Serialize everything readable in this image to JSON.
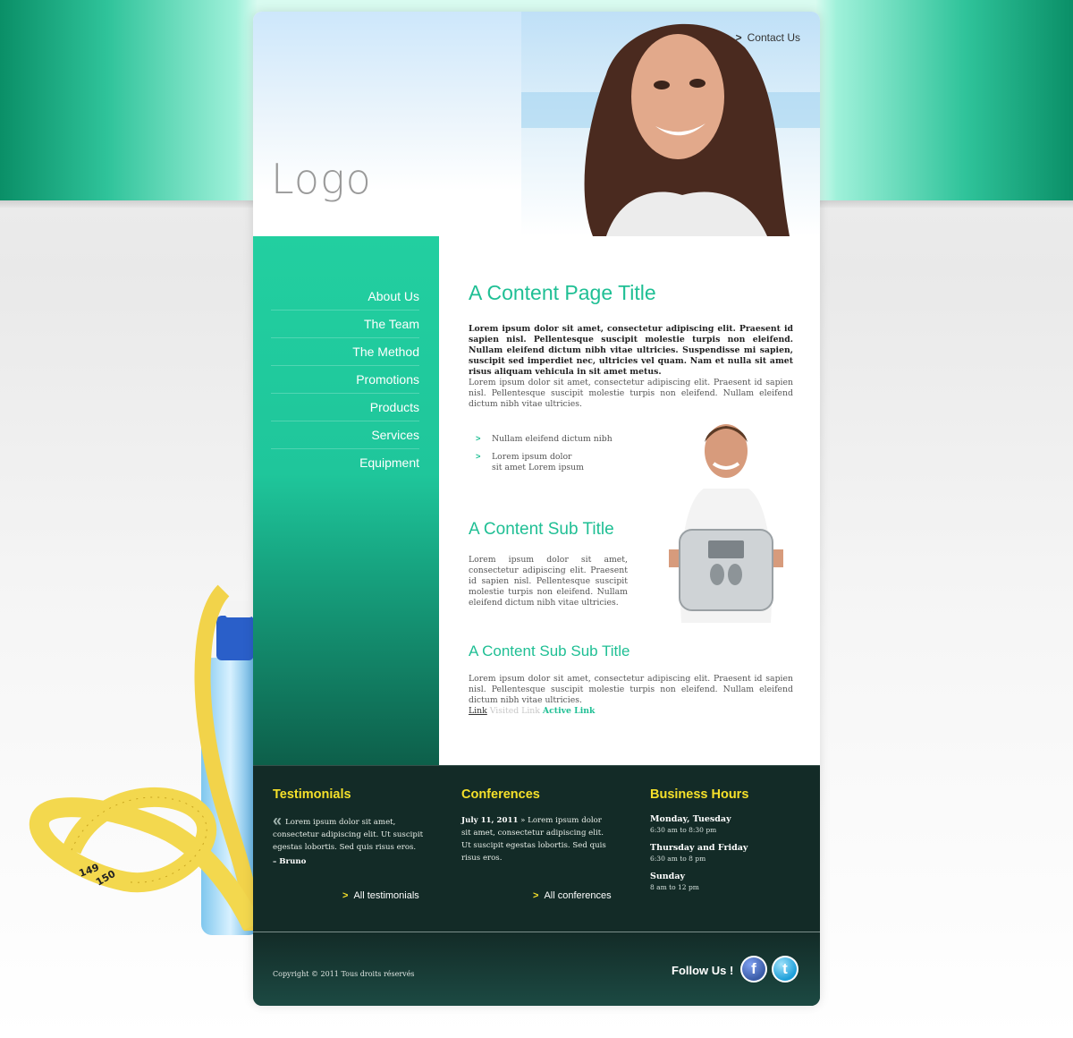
{
  "header": {
    "logo_text": "Logo",
    "contact_label": "Contact Us"
  },
  "nav": {
    "items": [
      {
        "label": "About Us"
      },
      {
        "label": "The Team"
      },
      {
        "label": "The Method"
      },
      {
        "label": "Promotions"
      },
      {
        "label": "Products"
      },
      {
        "label": "Services"
      },
      {
        "label": "Equipment"
      }
    ]
  },
  "main": {
    "title": "A Content Page Title",
    "lead": "Lorem ipsum dolor sit amet, consectetur adipiscing elit. Praesent id sapien nisl. Pellentesque suscipit molestie turpis non eleifend. Nullam eleifend dictum nibh vitae ultricies. Suspendisse mi sapien, suscipit sed imperdiet nec, ultricies vel quam. Nam et nulla sit amet risus aliquam vehicula in sit amet metus.",
    "paragraph1": "Lorem ipsum dolor sit amet, consectetur adipiscing elit. Praesent id sapien nisl. Pellentesque suscipit molestie turpis non eleifend. Nullam eleifend dictum nibh vitae ultricies.",
    "bullets": [
      "Nullam eleifend dictum nibh",
      "Lorem ipsum dolor\nsit amet Lorem ipsum"
    ],
    "subtitle": "A Content Sub Title",
    "paragraph2": "Lorem ipsum dolor sit amet, consectetur adipiscing elit. Praesent id sapien nisl. Pellentesque suscipit molestie turpis non eleifend. Nullam eleifend dictum nibh vitae ultricies.",
    "subsubtitle": "A Content Sub Sub Title",
    "paragraph3": "Lorem ipsum dolor sit amet, consectetur adipiscing elit. Praesent id sapien nisl. Pellentesque suscipit molestie turpis non eleifend. Nullam eleifend dictum nibh vitae ultricies.",
    "links": {
      "link": "Link",
      "visited": "Visited Link",
      "active": "Active Link"
    }
  },
  "footer": {
    "testimonials": {
      "title": "Testimonials",
      "text": "Lorem ipsum dolor sit amet, consectetur adipiscing elit. Ut suscipit egestas lobortis. Sed quis risus eros.",
      "author": "– Bruno",
      "more_label": "All testimonials"
    },
    "conferences": {
      "title": "Conferences",
      "date": "July 11, 2011",
      "text": " » Lorem ipsum dolor sit amet, consectetur adipiscing elit. Ut suscipit egestas lobortis. Sed quis risus eros.",
      "more_label": "All conferences"
    },
    "hours": {
      "title": "Business Hours",
      "entries": [
        {
          "day": "Monday, Tuesday",
          "time": "6:30 am to 8:30 pm"
        },
        {
          "day": "Thursday and Friday",
          "time": "6:30 am to 8 pm"
        },
        {
          "day": "Sunday",
          "time": "8 am to 12 pm"
        }
      ]
    },
    "copyright": "Copyright © 2011 Tous droits réservés",
    "follow_label": "Follow Us !"
  },
  "colors": {
    "accent": "#1fbf94",
    "footer_bg": "#132b27",
    "footer_title": "#f5e02a"
  },
  "icons": {
    "contact": "chevron-right-icon",
    "quote": "quote-icon",
    "social": [
      "facebook-icon",
      "twitter-icon"
    ]
  }
}
